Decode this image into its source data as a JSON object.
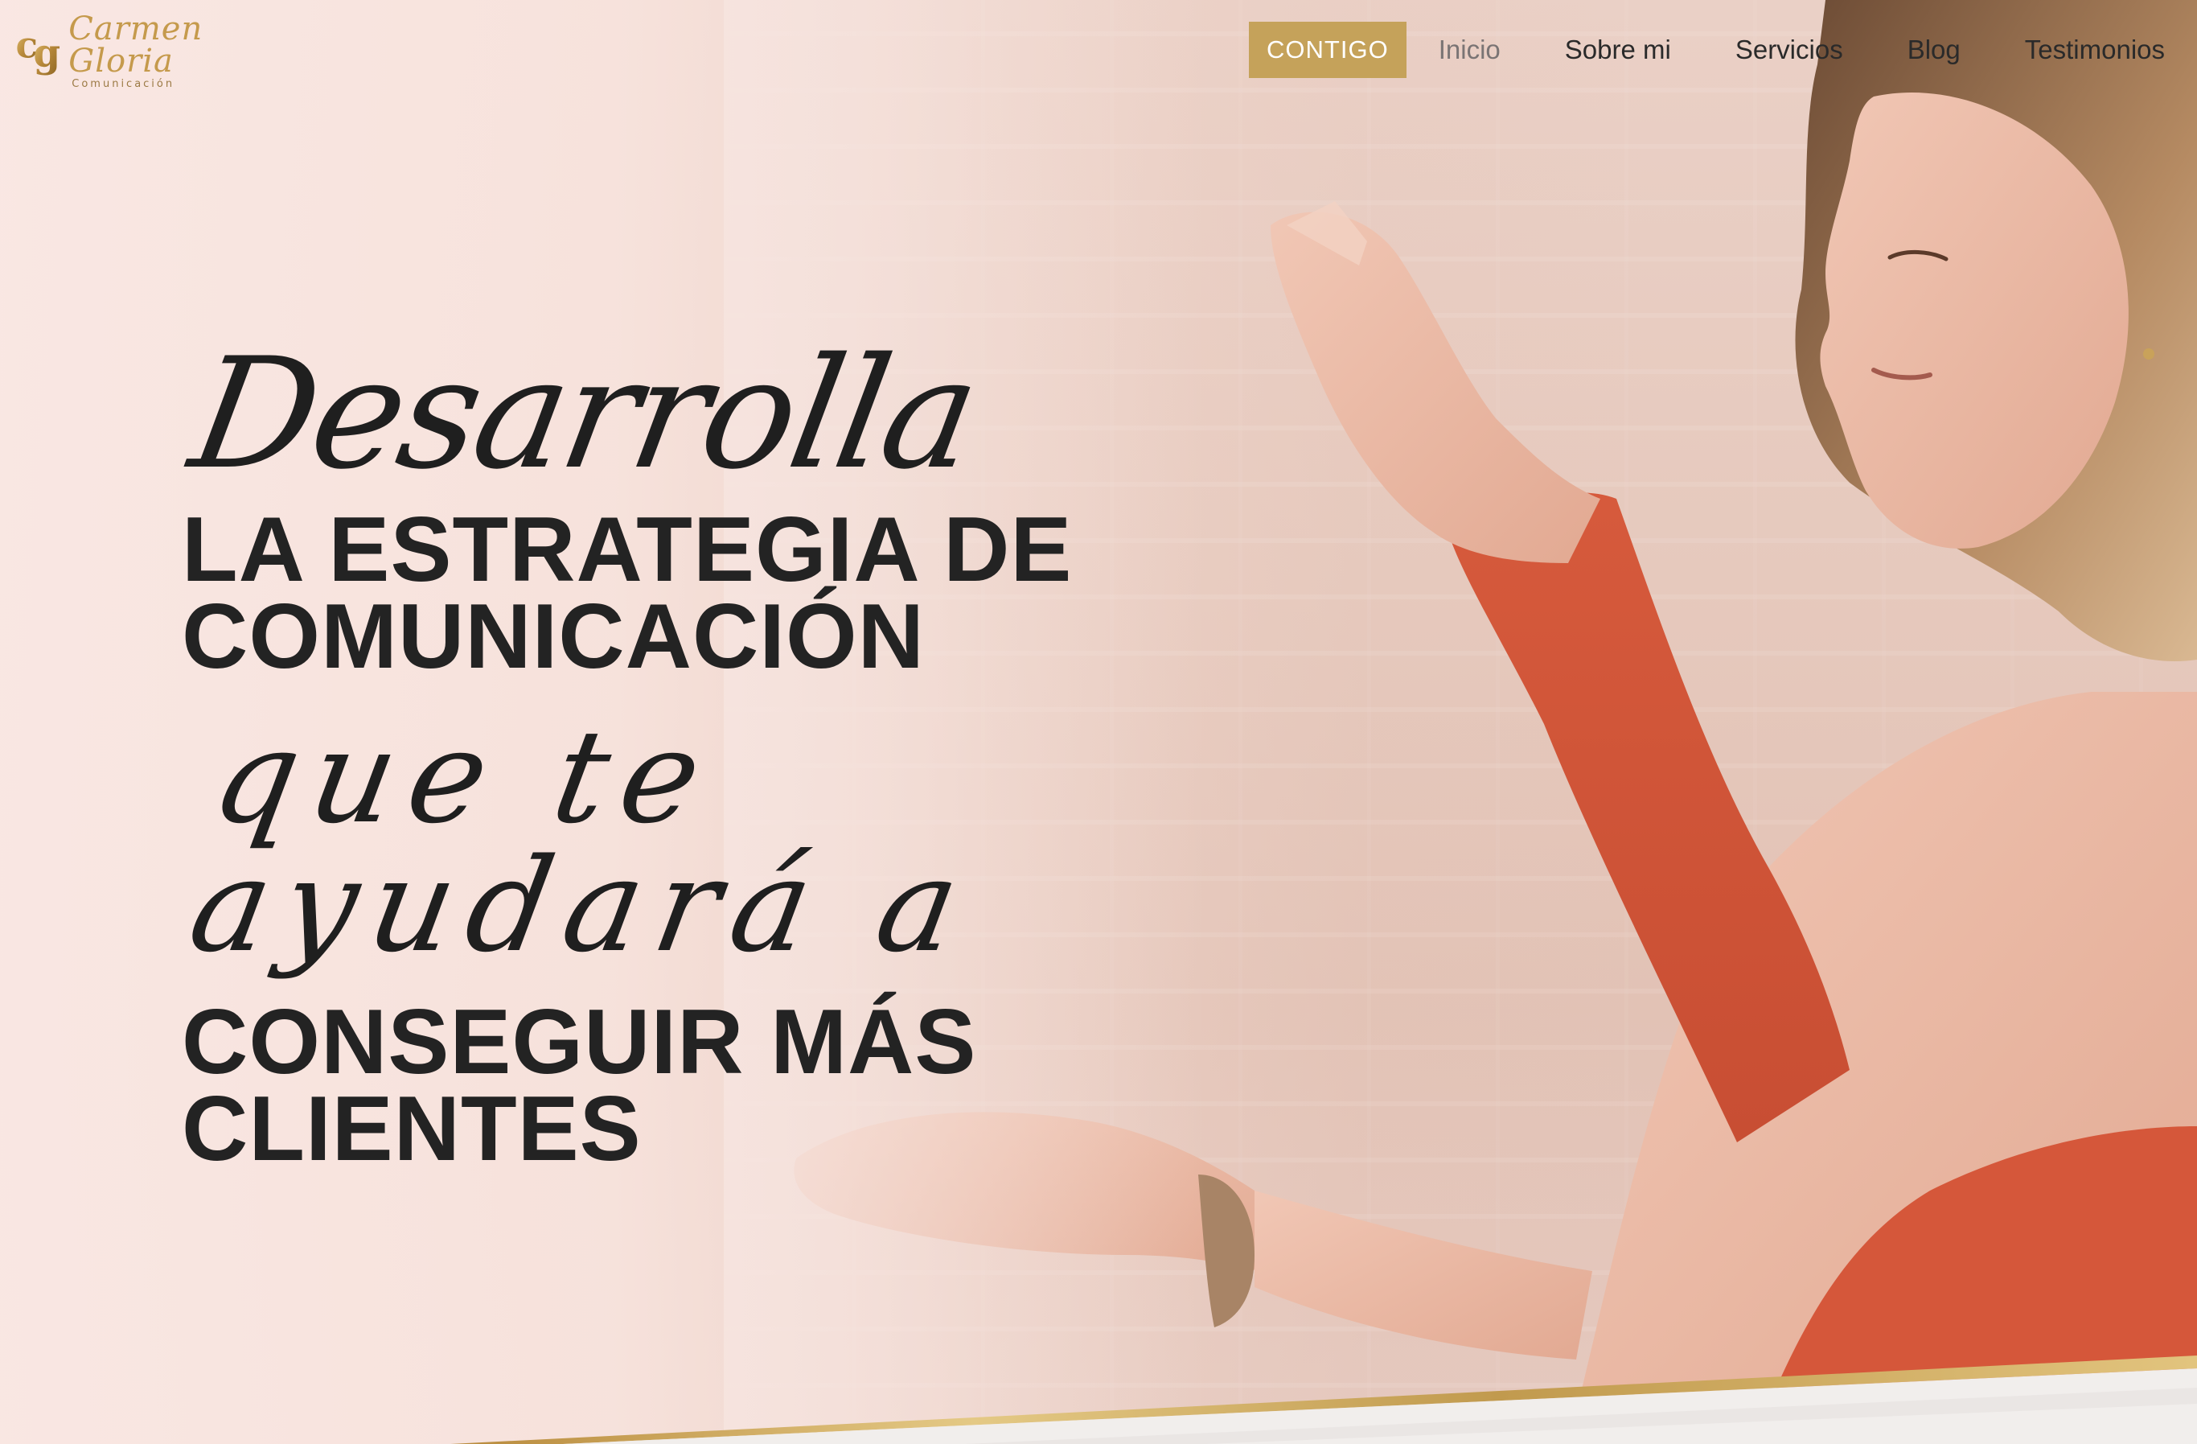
{
  "brand": {
    "name": "Carmen Gloria",
    "subtitle": "Comunicación",
    "monogram": "cg"
  },
  "nav": {
    "cta_label": "CONTIGO",
    "items": [
      {
        "label": "Inicio",
        "active": true
      },
      {
        "label": "Sobre mi",
        "active": false
      },
      {
        "label": "Servicios",
        "active": false
      },
      {
        "label": "Blog",
        "active": false
      },
      {
        "label": "Testimonios",
        "active": false
      }
    ]
  },
  "hero": {
    "script_line_1": "Desarrolla",
    "heading_line_1": "LA ESTRATEGIA DE",
    "heading_line_2": "COMUNICACIÓN",
    "script_line_2": "que te ayudará a",
    "heading_line_3": "CONSEGUIR MÁS",
    "heading_line_4": "CLIENTES"
  },
  "colors": {
    "accent_gold": "#c5a25a",
    "text_dark": "#232323",
    "hero_background": "#f6e4df",
    "sleeve_orange": "#d0583a"
  }
}
